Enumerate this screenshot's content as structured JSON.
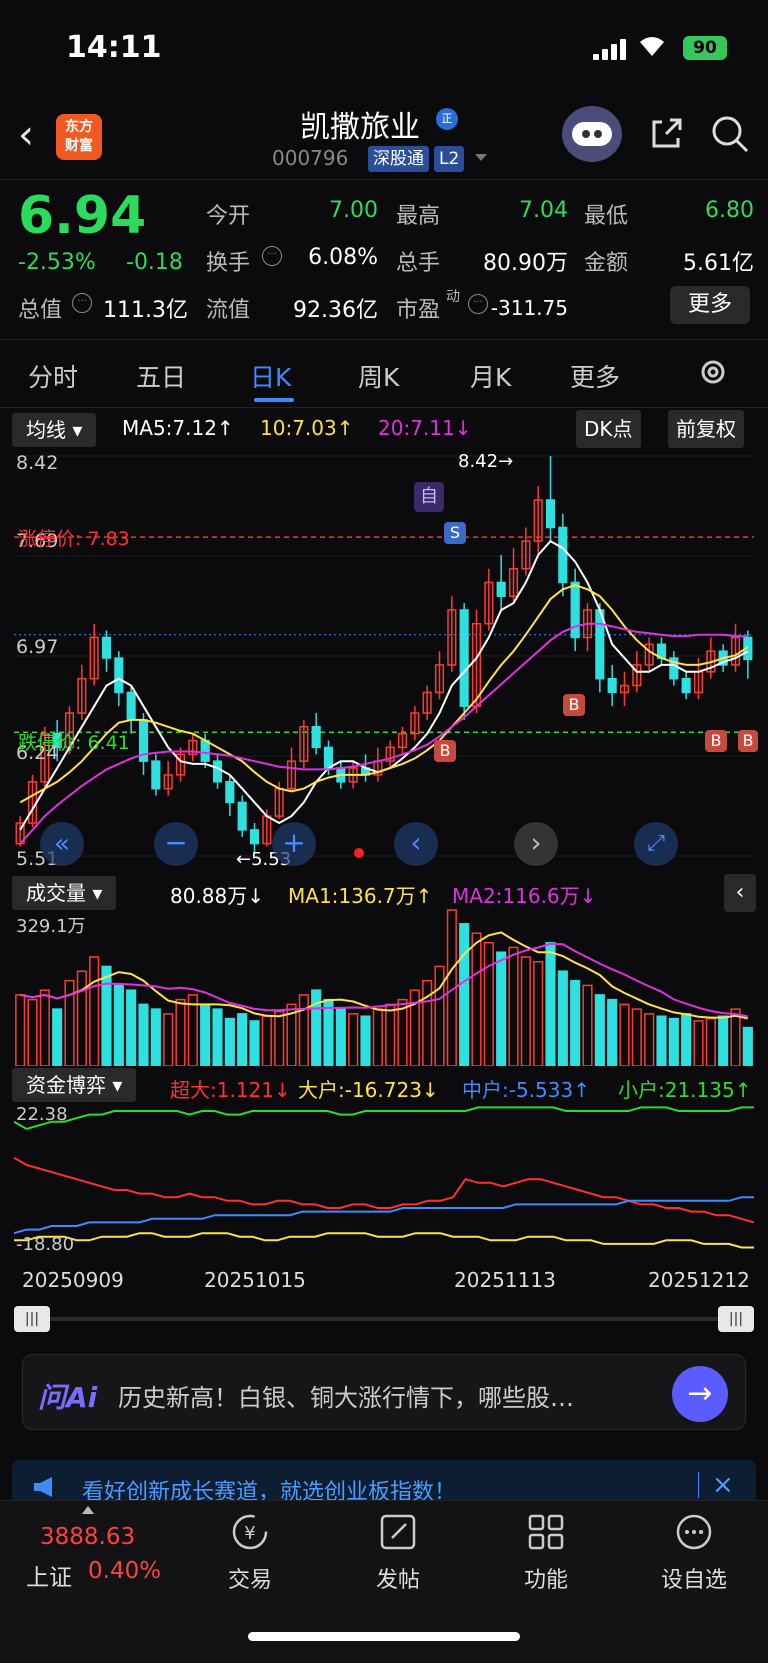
{
  "status": {
    "time": "14:11",
    "battery": "90"
  },
  "header": {
    "title": "凯撒旅业",
    "title_badge": "正",
    "code": "000796",
    "tag1": "深股通",
    "tag2": "L2",
    "logo_line1": "东方",
    "logo_line2": "财富"
  },
  "quote": {
    "price": "6.94",
    "pct": "-2.53%",
    "chg": "-0.18",
    "open_lbl": "今开",
    "open": "7.00",
    "high_lbl": "最高",
    "high": "7.04",
    "low_lbl": "最低",
    "low": "6.80",
    "turnover_lbl": "换手",
    "turnover": "6.08%",
    "volume_lbl": "总手",
    "volume": "80.90万",
    "amount_lbl": "金额",
    "amount": "5.61亿",
    "mktcap_lbl": "总值",
    "mktcap": "111.3亿",
    "float_lbl": "流值",
    "float": "92.36亿",
    "pe_lbl": "市盈",
    "pe_sup": "动",
    "pe": "-311.75",
    "more": "更多"
  },
  "tabs": [
    "分时",
    "五日",
    "日K",
    "周K",
    "月K",
    "更多"
  ],
  "chart": {
    "indicator": "均线",
    "ma5": "MA5:7.12↑",
    "ma10": "10:7.03↑",
    "ma20": "20:7.11↓",
    "dk": "DK点",
    "adjust": "前复权",
    "y_top": "8.42",
    "y_2": "7.69",
    "y_3": "6.97",
    "y_4": "6.24",
    "y_bottom": "5.51",
    "limit_up": "涨停价: 7.83",
    "limit_down": "跌停价: 6.41",
    "hi_mark": "8.42→",
    "lo_mark": "←5.53",
    "self_tag": "自",
    "s_tag": "S",
    "b_tag": "B"
  },
  "colors": {
    "up": "#ff3b30",
    "down": "#2fe0e0",
    "ma5": "#ffffff",
    "ma10": "#ffe14a",
    "ma20": "#e030e0",
    "super": "#ff3030",
    "big": "#ffe14a",
    "mid": "#3d8bff",
    "small": "#2bdc2b"
  },
  "volume": {
    "label": "成交量",
    "value": "80.88万↓",
    "ma1": "MA1:136.7万↑",
    "ma2": "MA2:116.6万↓",
    "top": "329.1万"
  },
  "fund": {
    "label": "资金博弈",
    "super": "超大:1.121↓",
    "big": "大户:-16.723↓",
    "mid": "中户:-5.533↑",
    "small": "小户:21.135↑",
    "top": "22.38",
    "bottom": "-18.80"
  },
  "dates": [
    "20250909",
    "20251015",
    "20251113",
    "20251212"
  ],
  "ai": {
    "logo": "问Ai",
    "text": "历史新高！白银、铜大涨行情下，哪些股…"
  },
  "ad": {
    "text": "看好创新成长赛道，就选创业板指数！"
  },
  "nav": {
    "index_value": "3888.63",
    "index_name": "上证",
    "index_chg": "0.40%",
    "items": [
      "交易",
      "发帖",
      "功能",
      "设自选"
    ]
  },
  "chart_data": {
    "type": "candlestick",
    "ylim": [
      5.51,
      8.42
    ],
    "candles": [
      [
        5.6,
        5.75,
        5.58,
        5.8
      ],
      [
        5.75,
        6.05,
        5.72,
        6.1
      ],
      [
        6.05,
        6.4,
        6.0,
        6.45
      ],
      [
        6.4,
        6.3,
        6.2,
        6.5
      ],
      [
        6.3,
        6.55,
        6.25,
        6.6
      ],
      [
        6.55,
        6.8,
        6.5,
        6.9
      ],
      [
        6.8,
        7.1,
        6.75,
        7.2
      ],
      [
        7.1,
        6.95,
        6.85,
        7.15
      ],
      [
        6.95,
        6.7,
        6.6,
        7.0
      ],
      [
        6.7,
        6.5,
        6.4,
        6.75
      ],
      [
        6.5,
        6.2,
        6.1,
        6.55
      ],
      [
        6.2,
        6.0,
        5.95,
        6.25
      ],
      [
        6.0,
        6.1,
        5.95,
        6.2
      ],
      [
        6.1,
        6.25,
        6.05,
        6.3
      ],
      [
        6.25,
        6.35,
        6.2,
        6.4
      ],
      [
        6.35,
        6.2,
        6.15,
        6.4
      ],
      [
        6.2,
        6.05,
        6.0,
        6.25
      ],
      [
        6.05,
        5.9,
        5.8,
        6.1
      ],
      [
        5.9,
        5.7,
        5.65,
        5.95
      ],
      [
        5.7,
        5.6,
        5.53,
        5.75
      ],
      [
        5.6,
        5.8,
        5.58,
        5.85
      ],
      [
        5.8,
        6.0,
        5.78,
        6.05
      ],
      [
        6.0,
        6.2,
        5.98,
        6.3
      ],
      [
        6.2,
        6.45,
        6.15,
        6.5
      ],
      [
        6.45,
        6.3,
        6.25,
        6.55
      ],
      [
        6.3,
        6.15,
        6.1,
        6.35
      ],
      [
        6.15,
        6.05,
        6.0,
        6.2
      ],
      [
        6.05,
        6.15,
        6.0,
        6.2
      ],
      [
        6.15,
        6.1,
        6.05,
        6.25
      ],
      [
        6.1,
        6.2,
        6.05,
        6.3
      ],
      [
        6.2,
        6.3,
        6.15,
        6.35
      ],
      [
        6.3,
        6.4,
        6.25,
        6.45
      ],
      [
        6.4,
        6.55,
        6.35,
        6.6
      ],
      [
        6.55,
        6.7,
        6.5,
        6.75
      ],
      [
        6.7,
        6.9,
        6.65,
        7.0
      ],
      [
        6.9,
        7.3,
        6.85,
        7.4
      ],
      [
        7.3,
        6.6,
        6.5,
        7.35
      ],
      [
        6.6,
        7.2,
        6.55,
        7.3
      ],
      [
        7.2,
        7.5,
        7.15,
        7.6
      ],
      [
        7.5,
        7.4,
        7.3,
        7.7
      ],
      [
        7.4,
        7.6,
        7.35,
        7.75
      ],
      [
        7.6,
        7.8,
        7.55,
        7.9
      ],
      [
        7.8,
        8.1,
        7.7,
        8.2
      ],
      [
        8.1,
        7.9,
        7.8,
        8.42
      ],
      [
        7.9,
        7.5,
        7.4,
        8.0
      ],
      [
        7.5,
        7.1,
        7.0,
        7.6
      ],
      [
        7.1,
        7.3,
        7.0,
        7.35
      ],
      [
        7.3,
        6.8,
        6.7,
        7.35
      ],
      [
        6.8,
        6.7,
        6.6,
        6.9
      ],
      [
        6.7,
        6.75,
        6.6,
        6.85
      ],
      [
        6.75,
        6.9,
        6.7,
        7.0
      ],
      [
        6.9,
        7.05,
        6.85,
        7.1
      ],
      [
        7.05,
        6.95,
        6.9,
        7.1
      ],
      [
        6.95,
        6.8,
        6.75,
        7.0
      ],
      [
        6.8,
        6.7,
        6.65,
        6.85
      ],
      [
        6.7,
        6.85,
        6.65,
        6.95
      ],
      [
        6.85,
        7.0,
        6.8,
        7.1
      ],
      [
        7.0,
        6.9,
        6.85,
        7.05
      ],
      [
        6.9,
        7.1,
        6.85,
        7.2
      ],
      [
        7.1,
        6.94,
        6.8,
        7.15
      ]
    ],
    "ma5": [
      5.7,
      5.85,
      6.0,
      6.15,
      6.3,
      6.45,
      6.6,
      6.75,
      6.8,
      6.75,
      6.6,
      6.45,
      6.3,
      6.2,
      6.18,
      6.18,
      6.15,
      6.1,
      6.0,
      5.9,
      5.8,
      5.75,
      5.8,
      5.9,
      6.05,
      6.15,
      6.2,
      6.2,
      6.15,
      6.12,
      6.15,
      6.22,
      6.3,
      6.4,
      6.55,
      6.75,
      6.85,
      6.95,
      7.1,
      7.3,
      7.35,
      7.5,
      7.7,
      7.8,
      7.75,
      7.65,
      7.5,
      7.3,
      7.05,
      6.95,
      6.85,
      6.85,
      6.9,
      6.9,
      6.85,
      6.85,
      6.88,
      6.92,
      6.95,
      7.0
    ],
    "ma10": [
      5.9,
      5.95,
      6.0,
      6.05,
      6.12,
      6.2,
      6.3,
      6.4,
      6.48,
      6.5,
      6.5,
      6.48,
      6.45,
      6.42,
      6.4,
      6.35,
      6.3,
      6.25,
      6.2,
      6.12,
      6.05,
      6.0,
      5.98,
      6.0,
      6.05,
      6.08,
      6.1,
      6.1,
      6.1,
      6.12,
      6.15,
      6.18,
      6.22,
      6.28,
      6.35,
      6.45,
      6.55,
      6.65,
      6.78,
      6.9,
      7.0,
      7.12,
      7.25,
      7.38,
      7.45,
      7.48,
      7.45,
      7.4,
      7.3,
      7.18,
      7.08,
      7.0,
      6.95,
      6.92,
      6.9,
      6.9,
      6.92,
      6.95,
      6.97,
      7.03
    ],
    "ma20": [
      5.6,
      5.7,
      5.8,
      5.88,
      5.95,
      6.02,
      6.08,
      6.14,
      6.18,
      6.22,
      6.25,
      6.26,
      6.27,
      6.27,
      6.27,
      6.26,
      6.25,
      6.24,
      6.22,
      6.2,
      6.18,
      6.16,
      6.15,
      6.14,
      6.14,
      6.14,
      6.15,
      6.16,
      6.18,
      6.2,
      6.22,
      6.25,
      6.28,
      6.32,
      6.38,
      6.45,
      6.52,
      6.6,
      6.68,
      6.76,
      6.84,
      6.92,
      7.0,
      7.08,
      7.14,
      7.18,
      7.2,
      7.2,
      7.18,
      7.16,
      7.14,
      7.13,
      7.12,
      7.11,
      7.11,
      7.12,
      7.12,
      7.12,
      7.11,
      7.11
    ],
    "volume_max": 329.1,
    "volume": [
      150,
      140,
      160,
      120,
      180,
      200,
      230,
      210,
      170,
      160,
      130,
      120,
      110,
      140,
      150,
      130,
      120,
      100,
      110,
      95,
      105,
      115,
      130,
      150,
      160,
      140,
      120,
      110,
      105,
      120,
      130,
      140,
      160,
      180,
      210,
      329,
      300,
      280,
      260,
      240,
      250,
      230,
      220,
      260,
      200,
      180,
      170,
      150,
      140,
      130,
      120,
      110,
      105,
      100,
      110,
      95,
      100,
      105,
      120,
      81
    ],
    "fund_ylim": [
      -18.8,
      22.38
    ],
    "super": [
      8,
      6,
      5,
      4,
      3,
      2,
      1,
      0,
      -1,
      -1,
      -2,
      -2,
      -3,
      -3,
      -2,
      -3,
      -3,
      -4,
      -4,
      -5,
      -5,
      -4,
      -4,
      -5,
      -5,
      -6,
      -6,
      -5,
      -5,
      -6,
      -6,
      -5,
      -5,
      -4,
      -4,
      -3,
      2,
      1,
      1,
      0,
      1,
      2,
      2,
      1,
      0,
      -1,
      -2,
      -3,
      -3,
      -4,
      -5,
      -5,
      -6,
      -6,
      -7,
      -7,
      -8,
      -8,
      -9,
      -10
    ],
    "big": [
      -15,
      -15,
      -14,
      -14,
      -14,
      -15,
      -15,
      -14,
      -14,
      -14,
      -13,
      -13,
      -14,
      -14,
      -14,
      -13,
      -13,
      -13,
      -14,
      -14,
      -15,
      -15,
      -14,
      -14,
      -14,
      -13,
      -13,
      -13,
      -13,
      -14,
      -14,
      -14,
      -13,
      -13,
      -13,
      -14,
      -14,
      -14,
      -15,
      -15,
      -15,
      -14,
      -14,
      -14,
      -15,
      -15,
      -15,
      -16,
      -16,
      -16,
      -16,
      -16,
      -15,
      -15,
      -15,
      -16,
      -16,
      -16,
      -17,
      -17
    ],
    "mid": [
      -13,
      -12,
      -12,
      -11,
      -11,
      -11,
      -10,
      -10,
      -10,
      -10,
      -10,
      -9,
      -9,
      -9,
      -9,
      -9,
      -8,
      -8,
      -8,
      -8,
      -8,
      -8,
      -8,
      -7,
      -7,
      -7,
      -7,
      -7,
      -7,
      -7,
      -7,
      -6,
      -6,
      -6,
      -6,
      -6,
      -6,
      -6,
      -6,
      -6,
      -5,
      -5,
      -5,
      -5,
      -5,
      -5,
      -5,
      -5,
      -5,
      -4,
      -4,
      -4,
      -4,
      -4,
      -4,
      -4,
      -4,
      -4,
      -3,
      -3
    ],
    "small": [
      18,
      16,
      17,
      18,
      18,
      19,
      20,
      20,
      21,
      21,
      21,
      21,
      21,
      21,
      20,
      21,
      21,
      20,
      20,
      21,
      21,
      21,
      21,
      21,
      21,
      21,
      20,
      20,
      21,
      21,
      21,
      21,
      21,
      21,
      21,
      21,
      21,
      22,
      22,
      22,
      22,
      22,
      22,
      22,
      21,
      21,
      21,
      21,
      21,
      21,
      22,
      22,
      22,
      21,
      21,
      21,
      21,
      21,
      22,
      22
    ]
  }
}
